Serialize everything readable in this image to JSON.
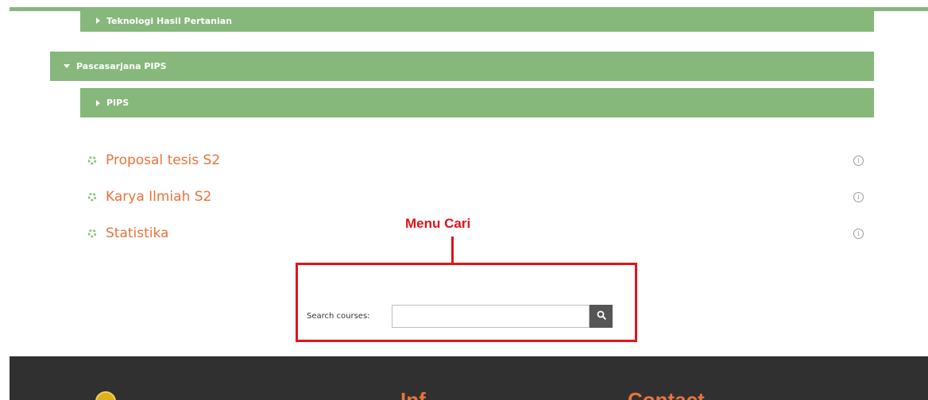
{
  "categories": {
    "thp": "Teknologi Hasil Pertanian",
    "pasca": "Pascasarjana PIPS",
    "pips": "PIPS"
  },
  "courses": [
    {
      "name": "Proposal tesis S2",
      "info": "i"
    },
    {
      "name": "Karya Ilmiah S2",
      "info": "i"
    },
    {
      "name": "Statistika",
      "info": "i"
    }
  ],
  "annotation": {
    "label": "Menu Cari"
  },
  "search": {
    "label": "Search courses:",
    "value": "",
    "placeholder": ""
  },
  "footer": {
    "text1": "Inf",
    "text2": "Contact"
  },
  "colors": {
    "category_bar": "#86b77b",
    "course_link": "#e8743a",
    "annotation": "#e0141c",
    "footer_bg": "#303030"
  }
}
